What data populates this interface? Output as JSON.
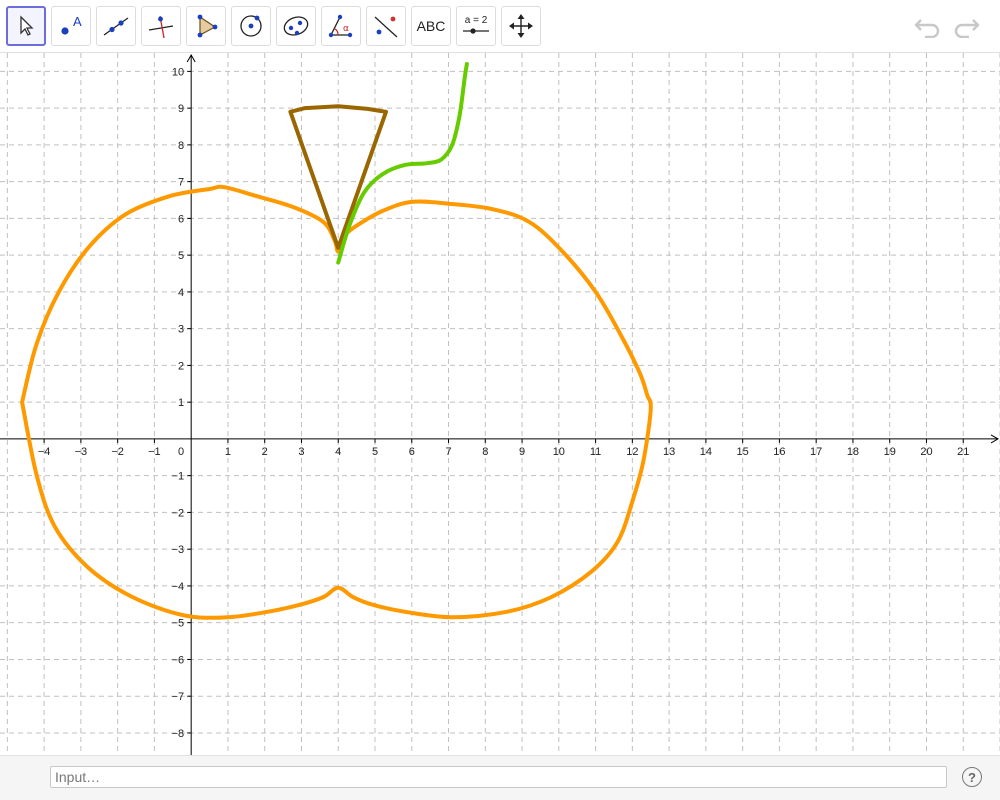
{
  "toolbar": {
    "tools": [
      {
        "name": "move-tool",
        "icon": "arrow-cursor-icon",
        "label": ""
      },
      {
        "name": "point-tool",
        "icon": "point-icon",
        "label": "A"
      },
      {
        "name": "line-tool",
        "icon": "line-through-points-icon",
        "label": ""
      },
      {
        "name": "perpendicular-tool",
        "icon": "perpendicular-line-icon",
        "label": ""
      },
      {
        "name": "polygon-tool",
        "icon": "polygon-icon",
        "label": ""
      },
      {
        "name": "circle-tool",
        "icon": "circle-center-point-icon",
        "label": ""
      },
      {
        "name": "conic-tool",
        "icon": "ellipse-icon",
        "label": ""
      },
      {
        "name": "angle-tool",
        "icon": "angle-icon",
        "label": "α"
      },
      {
        "name": "reflect-tool",
        "icon": "reflect-about-line-icon",
        "label": ""
      },
      {
        "name": "text-tool",
        "icon": "text-icon",
        "label": "ABC"
      },
      {
        "name": "slider-tool",
        "icon": "slider-icon",
        "label": "a = 2"
      },
      {
        "name": "move-graphics-tool",
        "icon": "move-graphics-icon",
        "label": ""
      }
    ],
    "selected": "move-tool",
    "undo_icon": "undo-icon",
    "redo_icon": "redo-icon"
  },
  "graphics": {
    "x_ticks": [
      -4,
      -3,
      -2,
      -1,
      1,
      2,
      3,
      4,
      5,
      6,
      7,
      8,
      9,
      10,
      11,
      12,
      13,
      14,
      15,
      16,
      17,
      18,
      19,
      20,
      21
    ],
    "y_ticks": [
      10,
      9,
      8,
      7,
      6,
      5,
      4,
      3,
      2,
      1,
      -1,
      -2,
      -3,
      -4,
      -5,
      -6,
      -7,
      -8
    ],
    "origin_label": "0",
    "x_range": [
      -5.2,
      22.0
    ],
    "y_range": [
      -8.6,
      10.5
    ],
    "grid": true,
    "colors": {
      "apple": "#ff9900",
      "stem": "#996600",
      "leaf": "#66cc00",
      "grid": "#c0c0c0",
      "axis": "#000000"
    },
    "curves": {
      "apple": [
        [
          -4.6,
          1.0
        ],
        [
          -4.2,
          2.6
        ],
        [
          -3.6,
          4.0
        ],
        [
          -2.8,
          5.2
        ],
        [
          -1.8,
          6.1
        ],
        [
          -0.6,
          6.6
        ],
        [
          0.5,
          6.8
        ],
        [
          0.9,
          6.85
        ],
        [
          1.8,
          6.6
        ],
        [
          2.8,
          6.3
        ],
        [
          3.6,
          5.9
        ],
        [
          3.9,
          5.4
        ],
        [
          4.0,
          5.1
        ],
        [
          4.15,
          5.5
        ],
        [
          4.5,
          5.8
        ],
        [
          5.2,
          6.2
        ],
        [
          6.0,
          6.45
        ],
        [
          7.0,
          6.4
        ],
        [
          8.2,
          6.25
        ],
        [
          9.2,
          5.9
        ],
        [
          10.1,
          5.1
        ],
        [
          11.0,
          4.0
        ],
        [
          11.7,
          2.8
        ],
        [
          12.2,
          1.8
        ],
        [
          12.4,
          1.2
        ],
        [
          12.5,
          0.8
        ],
        [
          12.3,
          -0.6
        ],
        [
          12.0,
          -1.7
        ],
        [
          11.6,
          -2.8
        ],
        [
          10.9,
          -3.6
        ],
        [
          9.8,
          -4.3
        ],
        [
          8.6,
          -4.7
        ],
        [
          7.1,
          -4.85
        ],
        [
          5.8,
          -4.7
        ],
        [
          4.9,
          -4.5
        ],
        [
          4.4,
          -4.3
        ],
        [
          4.0,
          -4.05
        ],
        [
          3.6,
          -4.3
        ],
        [
          3.0,
          -4.5
        ],
        [
          2.1,
          -4.7
        ],
        [
          1.0,
          -4.85
        ],
        [
          -0.2,
          -4.8
        ],
        [
          -1.6,
          -4.3
        ],
        [
          -2.8,
          -3.5
        ],
        [
          -3.7,
          -2.4
        ],
        [
          -4.2,
          -1.0
        ],
        [
          -4.6,
          1.0
        ]
      ],
      "stem": [
        [
          4.0,
          5.2
        ],
        [
          2.7,
          8.9
        ],
        [
          3.1,
          9.0
        ],
        [
          4.0,
          9.05
        ],
        [
          4.8,
          8.98
        ],
        [
          5.3,
          8.9
        ],
        [
          4.0,
          5.2
        ]
      ],
      "leaf": [
        [
          4.0,
          4.8
        ],
        [
          4.3,
          5.8
        ],
        [
          4.7,
          6.7
        ],
        [
          5.2,
          7.2
        ],
        [
          5.8,
          7.45
        ],
        [
          6.4,
          7.5
        ],
        [
          6.8,
          7.6
        ],
        [
          7.1,
          8.0
        ],
        [
          7.3,
          8.8
        ],
        [
          7.45,
          9.9
        ],
        [
          7.5,
          10.2
        ]
      ]
    }
  },
  "input_bar": {
    "placeholder": "Input…",
    "help_label": "?"
  }
}
